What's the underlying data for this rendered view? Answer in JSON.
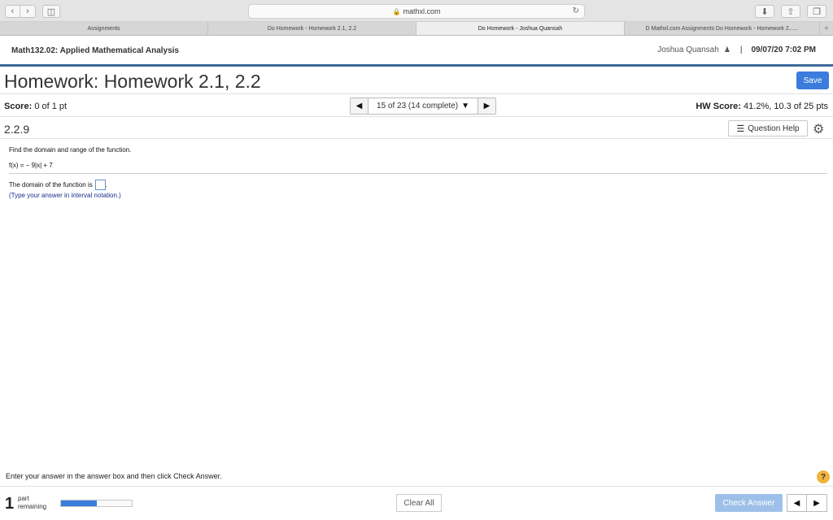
{
  "browser": {
    "url": "mathxl.com",
    "tabs": [
      {
        "label": "Assignments",
        "active": false
      },
      {
        "label": "Do Homework - Homework 2.1, 2.2",
        "active": false
      },
      {
        "label": "Do Homework - Joshua Quansah",
        "active": true
      },
      {
        "label": "D Mathxl.com Assignments Do Homework - Homework 2......",
        "active": false
      }
    ],
    "icons": {
      "back": "chevron-left-icon",
      "forward": "chevron-right-icon",
      "sidebar": "sidebar-icon",
      "lock": "lock-icon",
      "reload": "reload-icon",
      "download": "download-icon",
      "share": "share-icon",
      "tabs": "tabs-icon",
      "new_tab": "plus-icon"
    }
  },
  "header": {
    "course": "Math132.02: Applied Mathematical Analysis",
    "user": "Joshua Quansah",
    "separator": "|",
    "datetime": "09/07/20 7:02 PM"
  },
  "homework": {
    "title": "Homework: Homework 2.1, 2.2",
    "save_label": "Save"
  },
  "score": {
    "label": "Score:",
    "value": "0 of 1 pt",
    "pager_text": "15 of 23 (14 complete)",
    "hw_label": "HW Score:",
    "hw_value": "41.2%, 10.3 of 25 pts"
  },
  "question": {
    "number": "2.2.9",
    "help_label": "Question Help",
    "prompt": "Find the domain and range of the function.",
    "formula": "f(x) = − 9|x| + 7",
    "answer_prefix": "The domain of the function is",
    "answer_suffix": ".",
    "answer_value": "",
    "hint": "(Type your answer in interval notation.)"
  },
  "footer": {
    "instruction": "Enter your answer in the answer box and then click Check Answer.",
    "help_symbol": "?",
    "parts_count": "1",
    "parts_label_1": "part",
    "parts_label_2": "remaining",
    "progress_percent": 50,
    "clear_label": "Clear All",
    "check_label": "Check Answer"
  },
  "colors": {
    "accent": "#3b7ddd",
    "header_rule": "#3d6a9a",
    "check_disabled": "#9ec0e8",
    "hint_text": "#1b2f8f"
  }
}
